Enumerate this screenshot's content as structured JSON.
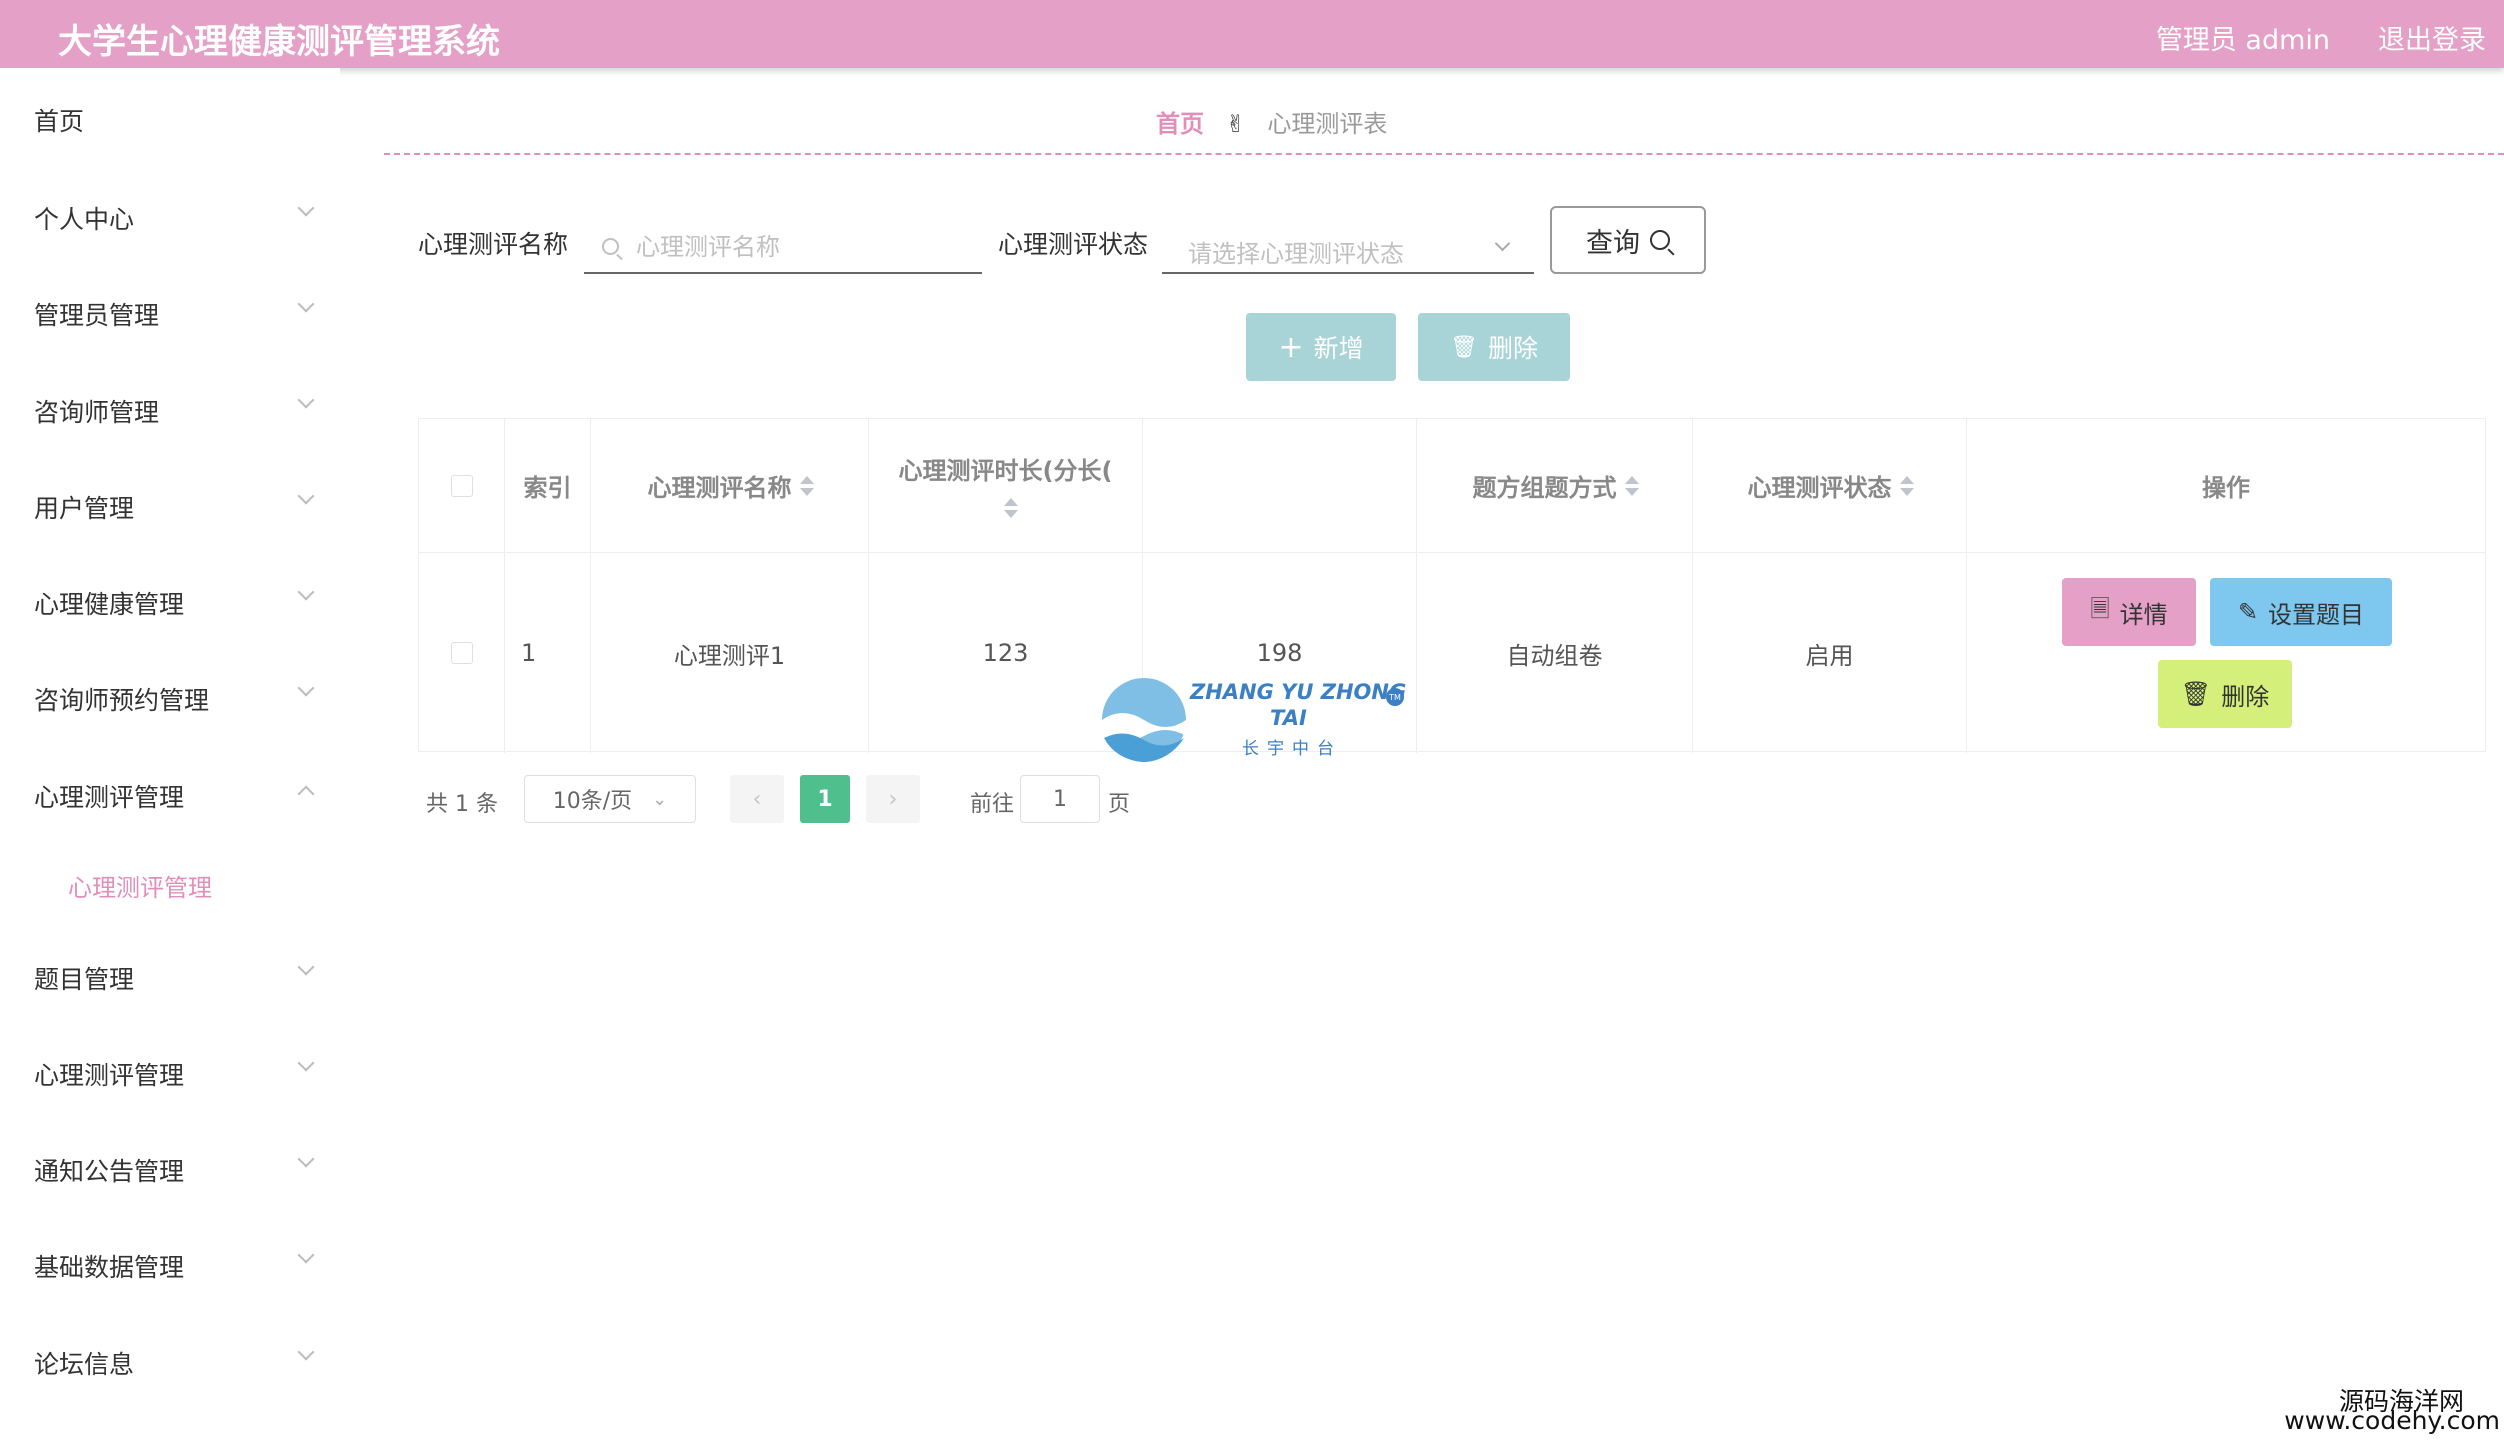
{
  "header": {
    "app_title": "大学生心理健康测评管理系统",
    "admin_label": "管理员 admin",
    "logout_label": "退出登录"
  },
  "sidebar": {
    "items": [
      {
        "label": "首页"
      },
      {
        "label": "个人中心"
      },
      {
        "label": "管理员管理"
      },
      {
        "label": "咨询师管理"
      },
      {
        "label": "用户管理"
      },
      {
        "label": "心理健康管理"
      },
      {
        "label": "咨询师预约管理"
      },
      {
        "label": "心理测评管理"
      },
      {
        "label": "题目管理"
      },
      {
        "label": "心理测评管理"
      },
      {
        "label": "通知公告管理"
      },
      {
        "label": "基础数据管理"
      },
      {
        "label": "论坛信息"
      }
    ],
    "active_sub": "心理测评管理"
  },
  "breadcrumb": {
    "home": "首页",
    "current": "心理测评表"
  },
  "search": {
    "name_label": "心理测评名称",
    "name_placeholder": "心理测评名称",
    "status_label": "心理测评状态",
    "status_placeholder": "请选择心理测评状态",
    "query_label": "查询"
  },
  "actions": {
    "add_label": "新增",
    "delete_label": "删除"
  },
  "table": {
    "headers": [
      "索引",
      "心理测评名称",
      "心理测评时长(分长(",
      "题方​组题方式",
      "心理测评状态",
      "操作"
    ],
    "rows": [
      {
        "index": "1",
        "name": "心理测评1",
        "duration": "123",
        "score": "198",
        "method": "自动组卷",
        "status": "启用",
        "buttons": {
          "detail": "详情",
          "set_questions": "设置题目",
          "delete": "删除"
        }
      }
    ]
  },
  "pagination": {
    "total_text": "共 1 条",
    "page_size": "10条/页",
    "current_page": "1",
    "goto_prefix": "前往",
    "goto_value": "1",
    "goto_suffix": "页"
  },
  "watermark": {
    "line1": "ZHANG YU ZHONG",
    "line2": "TAI",
    "line3": "长宇中台",
    "tm": "TM",
    "corner_line1": "源码海洋网",
    "corner_line2": "www.codehy.com"
  },
  "colors": {
    "header_bg": "#e4a0c6",
    "accent_pink": "#e08fbb",
    "action_btn": "#a8d4d8",
    "detail_btn": "#e4a0c6",
    "set_btn": "#7ec8f0",
    "delete_btn": "#d4f07a",
    "pager_active": "#4fc08d"
  }
}
